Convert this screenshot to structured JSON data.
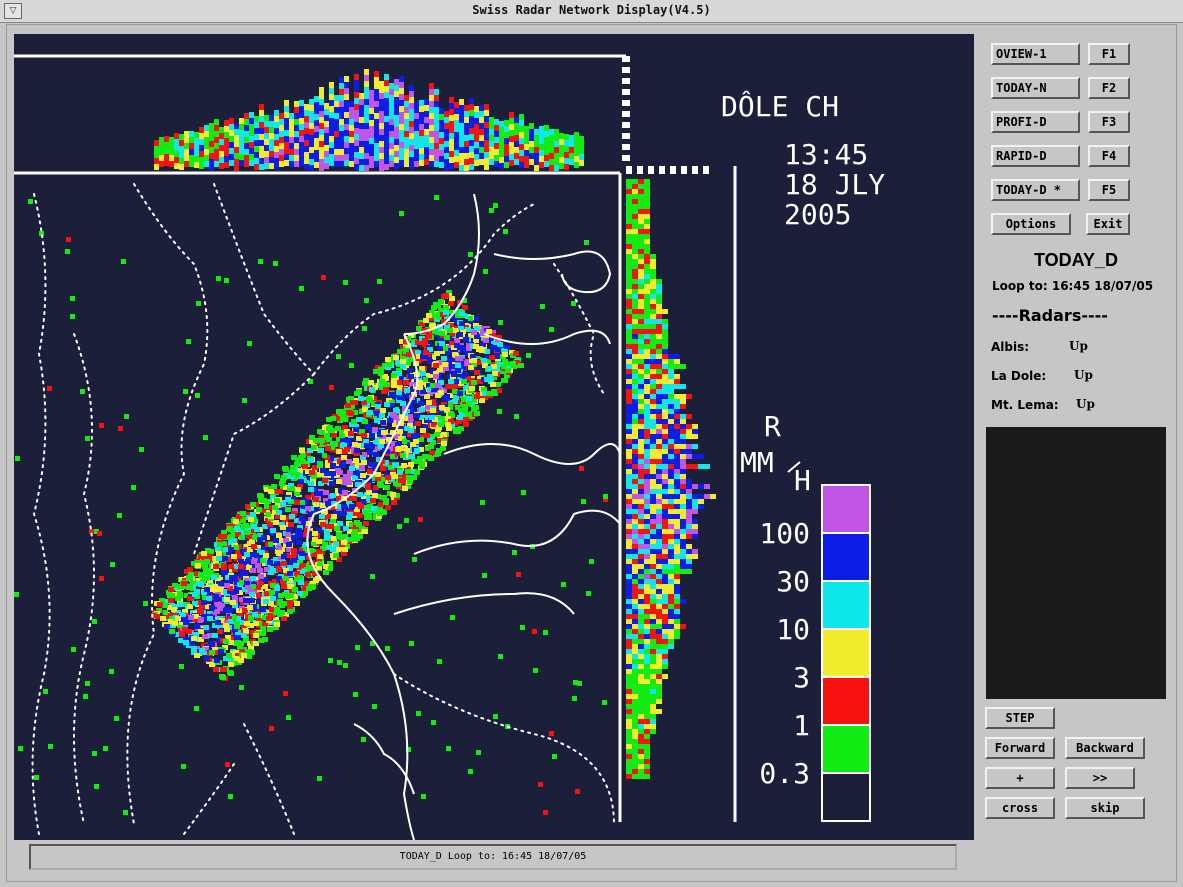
{
  "window": {
    "title": "Swiss Radar Network Display(V4.5)",
    "menu_glyph": "▽"
  },
  "radar": {
    "station": "DÔLE CH",
    "time": "13:45",
    "date": "18 JLY",
    "year": "2005",
    "unit_r": "R",
    "unit_mm": "MM",
    "unit_h": "H",
    "legend_levels": [
      "100",
      "30",
      "10",
      "3",
      "1",
      "0.3"
    ],
    "legend_colors": [
      "#c155e6",
      "#0b1de6",
      "#0ee8ea",
      "#f2ec2c",
      "#f5120f",
      "#12ec12",
      "#1c1f3a"
    ]
  },
  "product_buttons": [
    {
      "label": "OVIEW-1",
      "key": "F1"
    },
    {
      "label": "TODAY-N",
      "key": "F2"
    },
    {
      "label": "PROFI-D",
      "key": "F3"
    },
    {
      "label": "RAPID-D",
      "key": "F4"
    },
    {
      "label": "TODAY-D *",
      "key": "F5"
    }
  ],
  "options_label": "Options",
  "exit_label": "Exit",
  "status": {
    "product": "TODAY_D",
    "loop_to": "Loop to: 16:45  18/07/05",
    "radars_header": "----Radars----",
    "radars": [
      {
        "name": "Albis:",
        "state": "Up"
      },
      {
        "name": "La Dole:",
        "state": "Up"
      },
      {
        "name": "Mt. Lema:",
        "state": "Up"
      }
    ]
  },
  "controls": {
    "step": "STEP",
    "forward": "Forward",
    "backward": "Backward",
    "plus": "+",
    "fast": ">>",
    "cross": "cross",
    "skip": "skip"
  },
  "statusbar": "TODAY_D Loop to: 16:45  18/07/05"
}
